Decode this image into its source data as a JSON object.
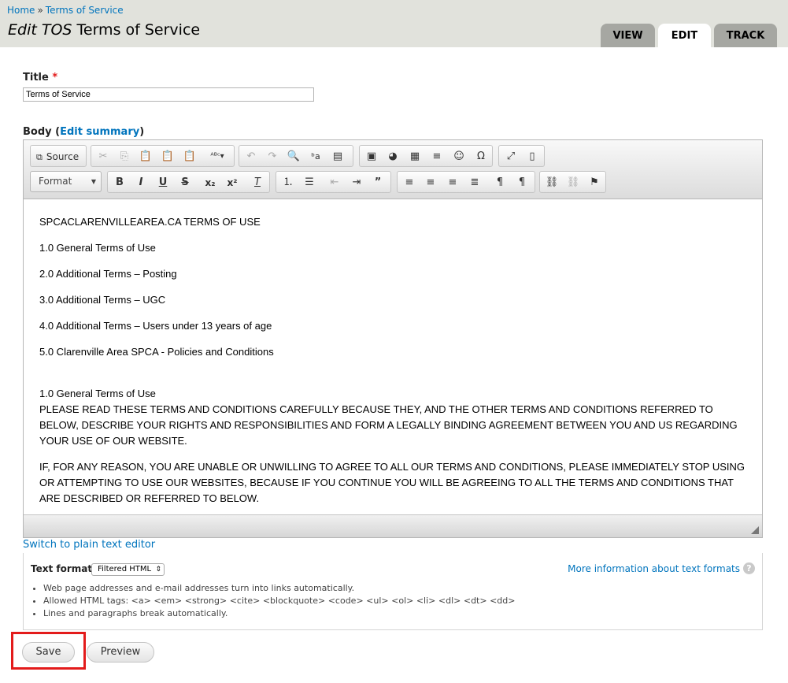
{
  "breadcrumb": {
    "home": "Home",
    "separator": "»",
    "current": "Terms of Service"
  },
  "page_title": {
    "prefix": "Edit TOS",
    "title": "Terms of Service"
  },
  "tabs": [
    {
      "label": "VIEW",
      "active": false
    },
    {
      "label": "EDIT",
      "active": true
    },
    {
      "label": "TRACK",
      "active": false
    }
  ],
  "form": {
    "title_label": "Title",
    "required_mark": "*",
    "title_value": "Terms of Service",
    "body_label": "Body",
    "edit_summary": "Edit summary"
  },
  "toolbar": {
    "source_label": "Source",
    "format_label": "Format",
    "icons": [
      "source-icon",
      "cut-icon",
      "copy-icon",
      "paste-icon",
      "paste-text-icon",
      "paste-word-icon",
      "spellcheck-icon",
      "undo-icon",
      "redo-icon",
      "find-icon",
      "replace-icon",
      "select-all-icon",
      "image-icon",
      "flash-icon",
      "table-icon",
      "horizontal-rule-icon",
      "smiley-icon",
      "special-char-icon",
      "maximize-icon",
      "show-blocks-icon",
      "bold-icon",
      "italic-icon",
      "underline-icon",
      "strike-icon",
      "subscript-icon",
      "superscript-icon",
      "remove-format-icon",
      "numbered-list-icon",
      "bulleted-list-icon",
      "outdent-icon",
      "indent-icon",
      "blockquote-icon",
      "align-left-icon",
      "align-center-icon",
      "align-right-icon",
      "justify-icon",
      "ltr-icon",
      "rtl-icon",
      "link-icon",
      "unlink-icon",
      "anchor-icon"
    ]
  },
  "content": {
    "heading": "SPCACLARENVILLEAREA.CA TERMS OF USE",
    "toc": [
      "1.0 General Terms of Use",
      "2.0 Additional Terms – Posting",
      "3.0 Additional Terms – UGC",
      "4.0 Additional Terms – Users under 13 years of age",
      "5.0 Clarenville Area SPCA - Policies and Conditions"
    ],
    "section_title": "1.0 General Terms of Use",
    "para1": "PLEASE READ THESE TERMS AND CONDITIONS CAREFULLY BECAUSE THEY, AND THE OTHER TERMS AND CONDITIONS REFERRED TO BELOW, DESCRIBE YOUR RIGHTS AND RESPONSIBILITIES AND FORM A LEGALLY BINDING AGREEMENT BETWEEN YOU AND US REGARDING YOUR USE OF OUR WEBSITE.",
    "para2": "IF, FOR ANY REASON, YOU ARE UNABLE OR UNWILLING TO AGREE TO ALL OUR TERMS AND CONDITIONS, PLEASE IMMEDIATELY STOP USING OR ATTEMPTING TO USE OUR WEBSITES, BECAUSE IF YOU CONTINUE YOU WILL BE AGREEING TO ALL THE TERMS AND CONDITIONS THAT ARE DESCRIBED OR REFERRED TO BELOW."
  },
  "editor_links": {
    "switch": "Switch to plain text editor"
  },
  "text_format": {
    "label": "Text format",
    "selected": "Filtered HTML",
    "more_info": "More information about text formats",
    "tips": [
      "Web page addresses and e-mail addresses turn into links automatically.",
      "Allowed HTML tags: <a> <em> <strong> <cite> <blockquote> <code> <ul> <ol> <li> <dl> <dt> <dd>",
      "Lines and paragraphs break automatically."
    ]
  },
  "actions": {
    "save": "Save",
    "preview": "Preview"
  },
  "colors": {
    "link": "#0074bd",
    "header_bg": "#e1e2dc",
    "tab_inactive": "#a6a7a2",
    "highlight": "#e31b1b"
  }
}
